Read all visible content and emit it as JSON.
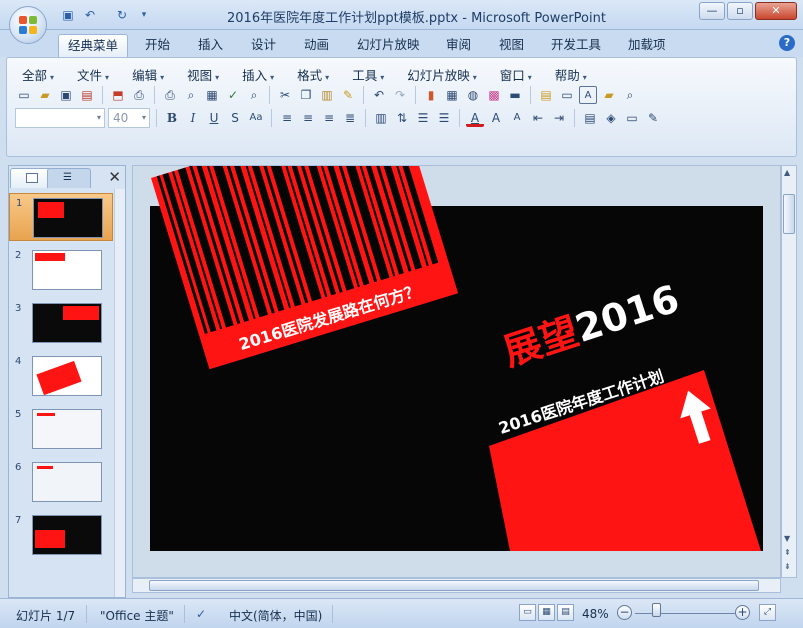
{
  "window": {
    "title": "2016年医院年度工作计划ppt模板.pptx - Microsoft PowerPoint",
    "controls": {
      "minimize": "—",
      "maximize": "▫",
      "close": "✕"
    }
  },
  "quick_access": [
    "save-icon",
    "undo-icon",
    "redo-icon",
    "customize-icon"
  ],
  "ribbon_tabs": [
    "经典菜单",
    "开始",
    "插入",
    "设计",
    "动画",
    "幻灯片放映",
    "审阅",
    "视图",
    "开发工具",
    "加载项"
  ],
  "active_tab": "经典菜单",
  "classic_menu": [
    "全部",
    "文件",
    "编辑",
    "视图",
    "插入",
    "格式",
    "工具",
    "幻灯片放映",
    "窗口",
    "帮助"
  ],
  "format_bar": {
    "font_name": "",
    "font_size": "40"
  },
  "slides": [
    {
      "number": "1",
      "selected": true
    },
    {
      "number": "2",
      "selected": false
    },
    {
      "number": "3",
      "selected": false
    },
    {
      "number": "4",
      "selected": false
    },
    {
      "number": "5",
      "selected": false
    },
    {
      "number": "6",
      "selected": false
    },
    {
      "number": "7",
      "selected": false
    }
  ],
  "slide_content": {
    "barcode_caption": "2016医院发展路在何方？",
    "headline_red": "展望",
    "headline_year": "2016",
    "subtitle": "2016医院年度工作计划"
  },
  "status": {
    "slide_indicator": "幻灯片 1/7",
    "theme": "\"Office 主题\"",
    "language": "中文(简体，中国)",
    "zoom": "48%",
    "zoom_level": 0.48
  },
  "colors": {
    "accent_red": "#ff1414",
    "slide_bg": "#060606"
  }
}
